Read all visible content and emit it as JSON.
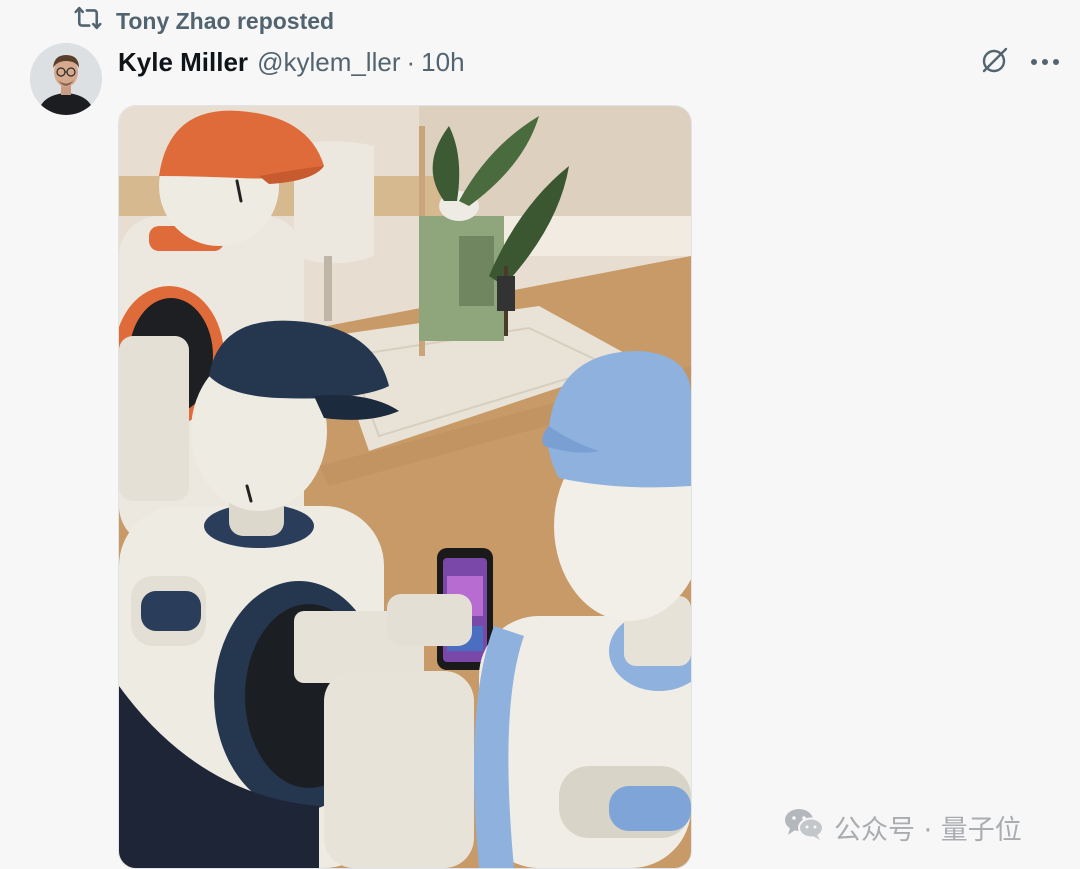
{
  "repost": {
    "text": "Tony Zhao reposted",
    "icon": "repost-icon"
  },
  "post": {
    "author_name": "Kyle Miller",
    "handle": "@kylem_ller",
    "separator": "·",
    "time": "10h",
    "avatar_icon": "avatar",
    "actions": {
      "grok_icon": "grok-icon",
      "more_icon": "more-icon"
    }
  },
  "media": {
    "icon": "robots-photo"
  },
  "watermark": {
    "text": "公众号 · 量子位",
    "icon": "wechat-icon"
  },
  "colors": {
    "secondary_text": "#536471",
    "primary_text": "#0f1419",
    "background": "#f7f7f7"
  }
}
